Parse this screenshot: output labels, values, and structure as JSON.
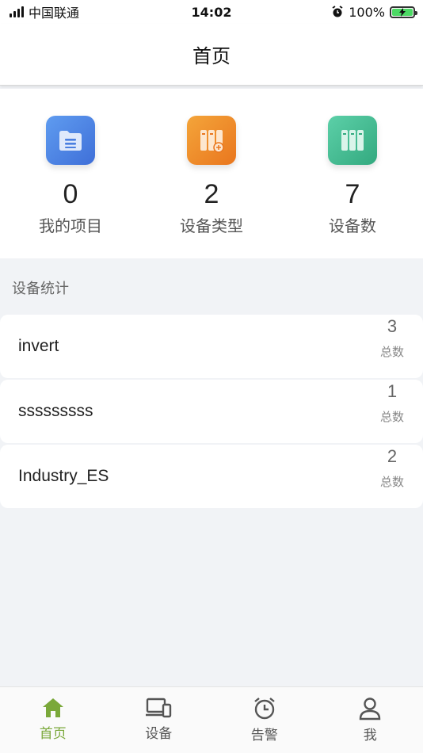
{
  "status_bar": {
    "carrier": "中国联通",
    "time": "14:02",
    "battery": "100%"
  },
  "nav": {
    "title": "首页"
  },
  "stats": [
    {
      "value": "0",
      "label": "我的项目",
      "icon": "folder-icon",
      "color": "#4a7fe0"
    },
    {
      "value": "2",
      "label": "设备类型",
      "icon": "device-type-icon",
      "color": "#ef8c2a"
    },
    {
      "value": "7",
      "label": "设备数",
      "icon": "device-count-icon",
      "color": "#3fb98f"
    }
  ],
  "section": {
    "title": "设备统计"
  },
  "devices": [
    {
      "name": "invert",
      "count": "3",
      "count_label": "总数"
    },
    {
      "name": "sssssssss",
      "count": "1",
      "count_label": "总数"
    },
    {
      "name": "Industry_ES",
      "count": "2",
      "count_label": "总数"
    }
  ],
  "tabs": [
    {
      "label": "首页",
      "icon": "home-icon",
      "active": true
    },
    {
      "label": "设备",
      "icon": "devices-icon",
      "active": false
    },
    {
      "label": "告警",
      "icon": "alarm-clock-icon",
      "active": false
    },
    {
      "label": "我",
      "icon": "user-icon",
      "active": false
    }
  ],
  "colors": {
    "accent": "#7aa83a",
    "background": "#f1f3f6"
  }
}
